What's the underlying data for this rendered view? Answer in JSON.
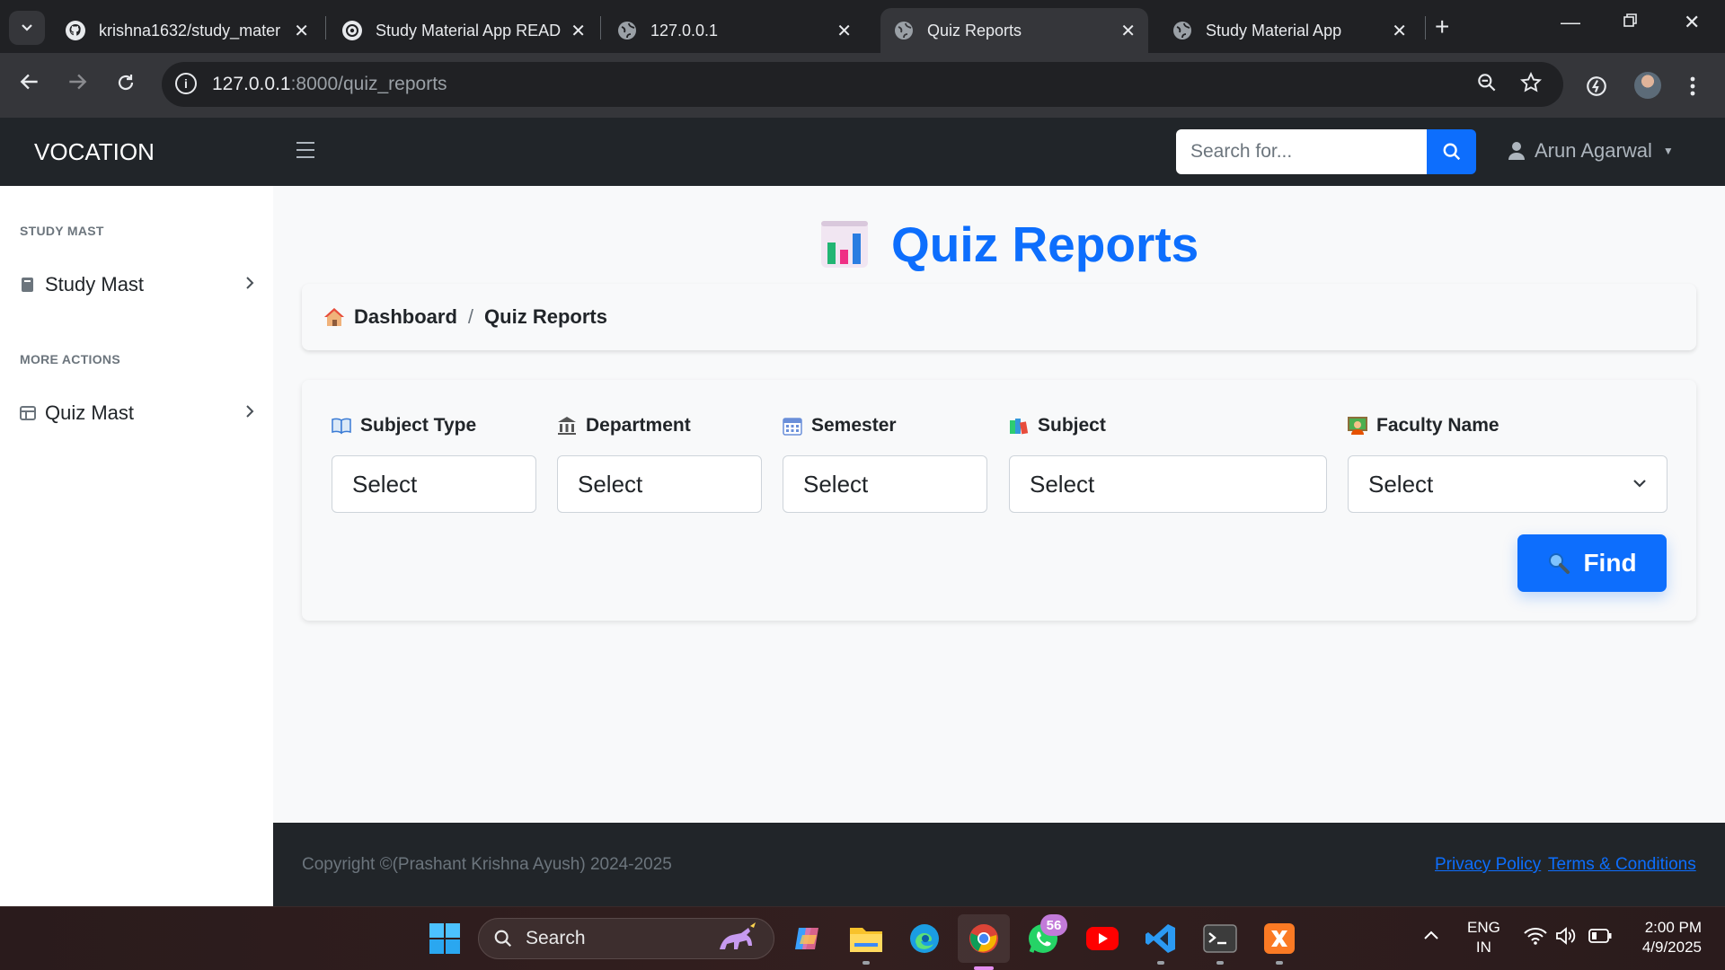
{
  "browser": {
    "tabs": [
      {
        "title": "krishna1632/study_mater",
        "icon": "github-icon"
      },
      {
        "title": "Study Material App READ",
        "icon": "openai-icon"
      },
      {
        "title": "127.0.0.1",
        "icon": "globe-icon"
      },
      {
        "title": "Quiz Reports",
        "icon": "globe-icon",
        "active": true
      },
      {
        "title": "Study Material App",
        "icon": "globe-icon"
      }
    ],
    "url_host": "127.0.0.1",
    "url_path": ":8000/quiz_reports"
  },
  "navbar": {
    "brand": "VOCATION",
    "search_placeholder": "Search for...",
    "user_name": "Arun Agarwal"
  },
  "sidebar": {
    "sections": [
      {
        "heading": "STUDY MAST",
        "item": "Study Mast"
      },
      {
        "heading": "MORE ACTIONS",
        "item": "Quiz Mast"
      }
    ]
  },
  "main": {
    "title": "Quiz Reports",
    "breadcrumb": [
      "Dashboard",
      "Quiz Reports"
    ],
    "filters": [
      {
        "label": "Subject Type",
        "value": "Select",
        "icon": "book-icon"
      },
      {
        "label": "Department",
        "value": "Select",
        "icon": "bank-icon"
      },
      {
        "label": "Semester",
        "value": "Select",
        "icon": "calendar-icon"
      },
      {
        "label": "Subject",
        "value": "Select",
        "icon": "books-icon"
      },
      {
        "label": "Faculty Name",
        "value": "Select",
        "icon": "teacher-icon"
      }
    ],
    "find_label": "Find"
  },
  "footer": {
    "copyright": "Copyright ©(Prashant Krishna Ayush) 2024-2025",
    "links": [
      "Privacy Policy",
      "Terms & Conditions"
    ]
  },
  "taskbar": {
    "search_label": "Search",
    "whatsapp_badge": "56",
    "lang_top": "ENG",
    "lang_bottom": "IN",
    "time": "2:00 PM",
    "date": "4/9/2025"
  },
  "colors": {
    "primary": "#0d6efd",
    "navbar_bg": "#212529",
    "chrome_bg": "#202124"
  }
}
